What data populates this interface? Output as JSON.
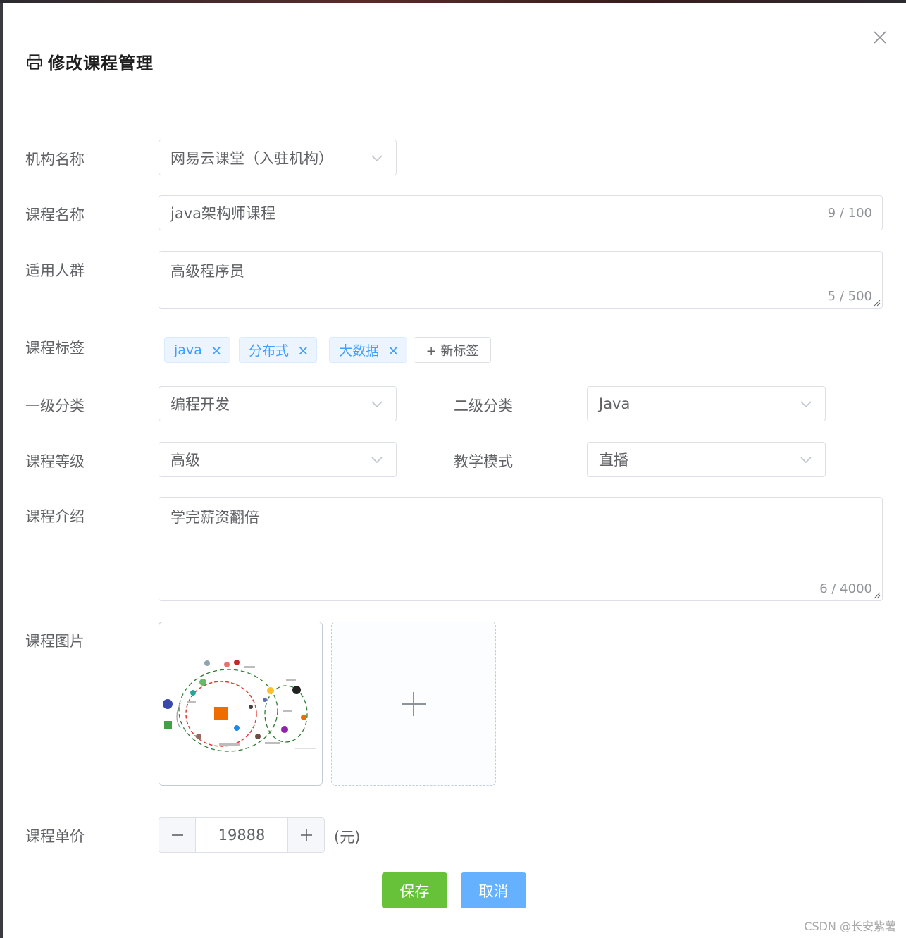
{
  "dialog": {
    "title": "修改课程管理",
    "icons": {
      "title": "printer-icon",
      "close": "close-icon"
    }
  },
  "form": {
    "org": {
      "label": "机构名称",
      "value": "网易云课堂（入驻机构）"
    },
    "course_name": {
      "label": "课程名称",
      "value": "java架构师课程",
      "count": "9 / 100"
    },
    "audience": {
      "label": "适用人群",
      "value": "高级程序员",
      "count": "5 / 500"
    },
    "tags": {
      "label": "课程标签",
      "items": [
        "java",
        "分布式",
        "大数据"
      ],
      "new_tag_label": "+ 新标签"
    },
    "category1": {
      "label": "一级分类",
      "value": "编程开发"
    },
    "category2": {
      "label": "二级分类",
      "value": "Java"
    },
    "level": {
      "label": "课程等级",
      "value": "高级"
    },
    "teach_mode": {
      "label": "教学模式",
      "value": "直播"
    },
    "intro": {
      "label": "课程介绍",
      "value": "学完薪资翻倍",
      "count": "6 / 4000"
    },
    "picture": {
      "label": "课程图片"
    },
    "price": {
      "label": "课程单价",
      "value": "19888",
      "unit": "(元)"
    }
  },
  "actions": {
    "save": "保存",
    "cancel": "取消"
  },
  "watermark": "CSDN @长安紫薯",
  "colors": {
    "primary": "#409eff",
    "success": "#67c23a",
    "cancel": "#66b1ff",
    "border": "#dcdfe6",
    "text": "#606266"
  }
}
